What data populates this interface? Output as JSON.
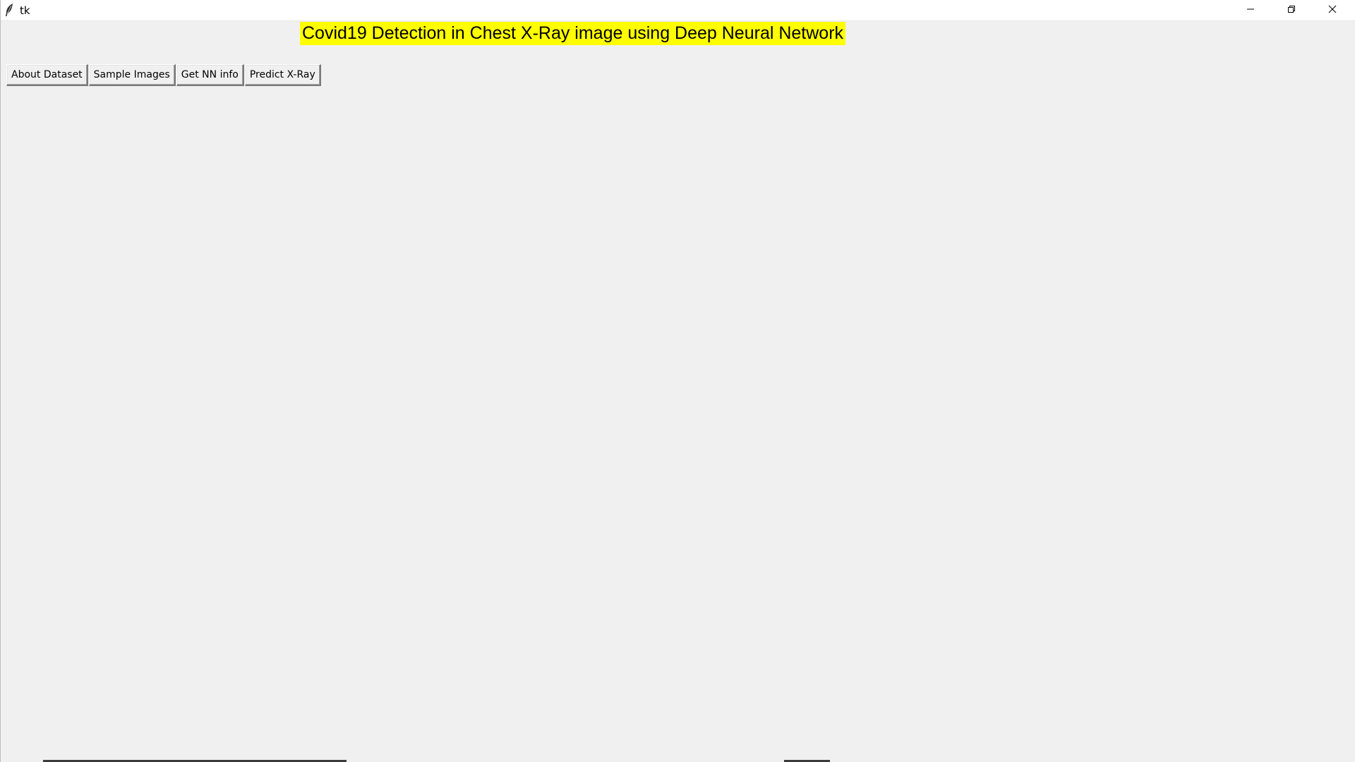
{
  "window": {
    "title": "tk",
    "controls": {
      "minimize": "minimize-icon",
      "maximize": "restore-icon",
      "close": "close-icon"
    }
  },
  "heading": {
    "text": "Covid19 Detection in Chest X-Ray image using Deep Neural Network",
    "background": "#ffff00"
  },
  "buttons": {
    "about_dataset": "About Dataset",
    "sample_images": "Sample Images",
    "nn_info": "Get NN info",
    "predict": "Predict X-Ray"
  }
}
